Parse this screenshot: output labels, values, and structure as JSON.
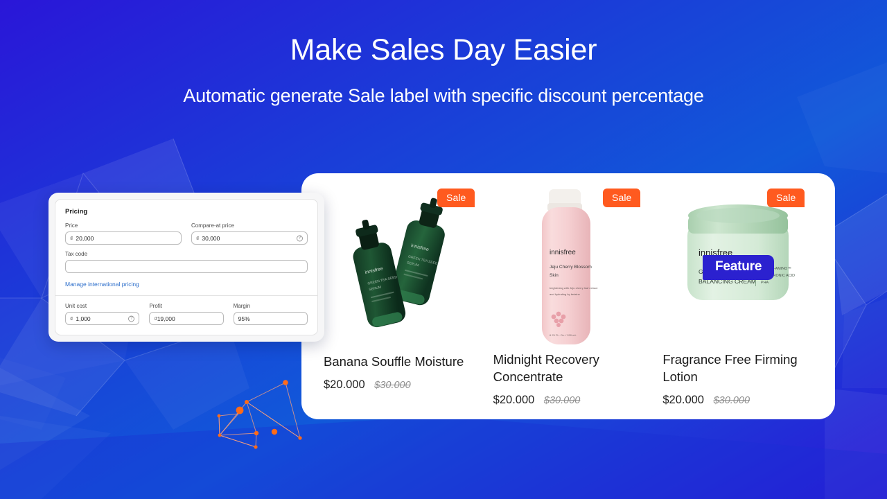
{
  "hero": {
    "headline": "Make Sales Day Easier",
    "subhead": "Automatic generate Sale label with specific discount percentage"
  },
  "theme": {
    "bg_from": "#2418d6",
    "bg_to": "#1257d8",
    "sale_badge_color": "#ff5a1f",
    "feature_badge_color": "#2b21cf",
    "link_color": "#2c6ecb",
    "panel_bg": "#ffffff",
    "accent_dot": "#ff6b18"
  },
  "pricing_card": {
    "section_title": "Pricing",
    "price": {
      "label": "Price",
      "currency": "₫",
      "value": "20,000",
      "has_help": false
    },
    "compare_at_price": {
      "label": "Compare-at price",
      "currency": "₫",
      "value": "30,000",
      "has_help": true
    },
    "tax_code": {
      "label": "Tax code",
      "value": "",
      "placeholder": ""
    },
    "manage_link": "Manage international pricing",
    "unit_cost": {
      "label": "Unit cost",
      "currency": "₫",
      "value": "1,000",
      "has_help": true
    },
    "profit": {
      "label": "Profit",
      "currency": "₫",
      "value": "19,000",
      "has_help": false
    },
    "margin": {
      "label": "Margin",
      "currency": "",
      "value": "95%",
      "has_help": false
    },
    "help_icon": "question-mark-circle-icon"
  },
  "product_panel": {
    "sale_label": "Sale",
    "feature_label": "Feature",
    "products": [
      {
        "title": "Banana Souffle Moisture",
        "price": "$20.000",
        "compare_price": "$30.000",
        "badge": "Sale",
        "image_alt": "two-green-serum-bottles",
        "brand": "innisfree",
        "product_line": "GREEN TEA SEED SERUM"
      },
      {
        "title": "Midnight Recovery Concentrate",
        "price": "$20.000",
        "compare_price": "$30.000",
        "badge": "Sale",
        "image_alt": "pink-toner-bottle",
        "brand": "innisfree",
        "product_line": "Jeju Cherry Blossom Skin",
        "product_desc": "brightening with Jeju cherry leaf extract and hydrating by betaine",
        "volume": "6.76 FL. Oz. / 200 mL"
      },
      {
        "title": "Fragrance Free Firming Lotion",
        "price": "$20.000",
        "compare_price": "$30.000",
        "badge": "Sale",
        "feature_badge": "Feature",
        "image_alt": "green-cream-jar",
        "brand": "innisfree",
        "product_line": "GREEN TEA BALANCING CREAM",
        "ingredients": [
          "TRIPLE-AMINO™",
          "HYALURONIC ACID",
          "PHA"
        ]
      }
    ]
  },
  "decor": {
    "constellation": "orange-network-graphic",
    "polygon_background": "low-poly-blue-facets"
  }
}
